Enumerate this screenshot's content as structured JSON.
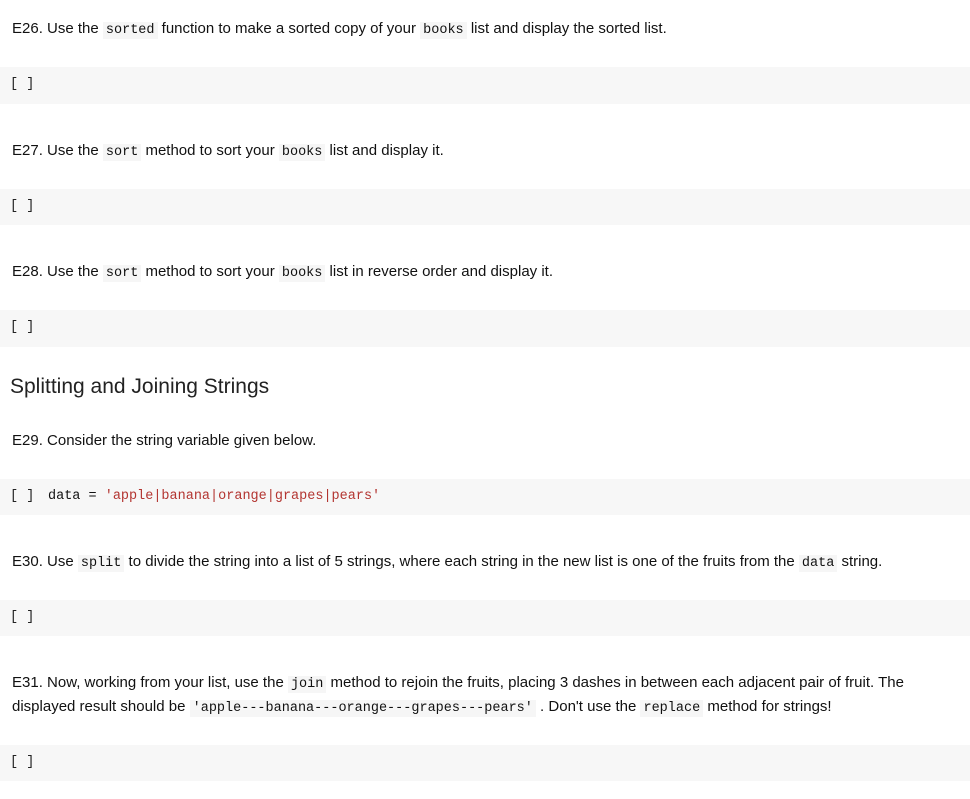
{
  "exercises": {
    "e26": {
      "pre": "E26. Use the ",
      "code1": "sorted",
      "mid1": " function to make a sorted copy of your ",
      "code2": "books",
      "post": " list and display the sorted list."
    },
    "e27": {
      "pre": "E27. Use the ",
      "code1": "sort",
      "mid1": " method to sort your ",
      "code2": "books",
      "post": " list and display it."
    },
    "e28": {
      "pre": "E28. Use the ",
      "code1": "sort",
      "mid1": " method to sort your ",
      "code2": "books",
      "post": " list in reverse order and display it."
    },
    "e29": {
      "text": "E29. Consider the string variable given below."
    },
    "e30": {
      "pre": "E30. Use ",
      "code1": "split",
      "mid1": " to divide the string into a list of 5 strings, where each string in the new list is one of the fruits from the ",
      "code2": "data",
      "post": " string."
    },
    "e31": {
      "pre": "E31. Now, working from your list, use the ",
      "code1": "join",
      "mid1": " method to rejoin the fruits, placing 3 dashes in between each adjacent pair of fruit. The displayed result should be ",
      "code2": "'apple---banana---orange---grapes---pears'",
      "mid2": " . Don't use the ",
      "code3": "replace",
      "post": " method for strings!"
    }
  },
  "section_heading": "Splitting and Joining Strings",
  "prompts": {
    "empty": "[ ]",
    "data_cell": "[ ]"
  },
  "code": {
    "data_line_prefix": "data = ",
    "data_line_string": "'apple|banana|orange|grapes|pears'"
  }
}
